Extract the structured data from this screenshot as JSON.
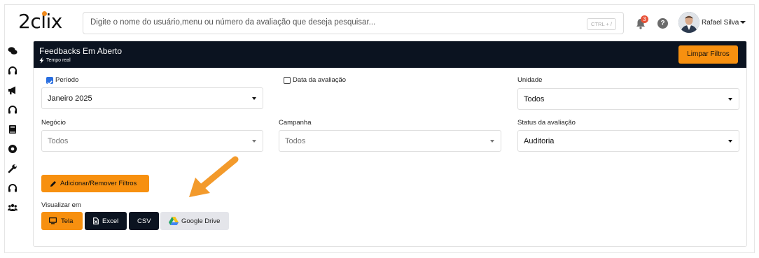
{
  "header": {
    "logo_text": "2clix",
    "search_placeholder": "Digite o nome do usuário,menu ou número da avaliação que deseja pesquisar...",
    "search_shortcut": "CTRL + /",
    "notification_count": "3",
    "help_symbol": "?",
    "user_name": "Rafael Silva"
  },
  "sidebar": {
    "icons": [
      "chat-icon",
      "headset-icon",
      "megaphone-icon",
      "headset-icon",
      "book-icon",
      "gear-icon",
      "wrench-icon",
      "headset-icon",
      "users-icon"
    ]
  },
  "panel": {
    "title": "Feedbacks Em Aberto",
    "subtitle": "Tempo real",
    "clear_filters": "Limpar Filtros"
  },
  "filters": {
    "periodo": {
      "label": "Período",
      "checked": true,
      "value": "Janeiro 2025"
    },
    "data_avaliacao": {
      "label": "Data da avaliação",
      "checked": false
    },
    "unidade": {
      "label": "Unidade",
      "value": "Todos"
    },
    "negocio": {
      "label": "Negócio",
      "value": "Todos"
    },
    "campanha": {
      "label": "Campanha",
      "value": "Todos"
    },
    "status": {
      "label": "Status da avaliação",
      "value": "Auditoria"
    }
  },
  "actions": {
    "add_remove_filters": "Adicionar/Remover Filtros",
    "view_label": "Visualizar em",
    "view_options": [
      "Tela",
      "Excel",
      "CSV",
      "Google Drive"
    ]
  },
  "colors": {
    "accent": "#f7900f",
    "dark": "#0b1320",
    "checkbox": "#2a6fe0",
    "badge": "#e8543a"
  }
}
